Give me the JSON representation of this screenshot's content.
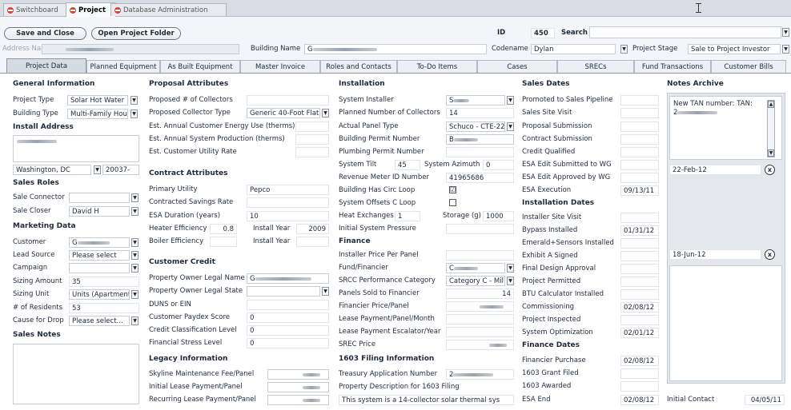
{
  "doc_tabs": [
    "Switchboard",
    "Project",
    "Database Administration"
  ],
  "buttons": {
    "save_close": "Save and Close",
    "open_folder": "Open Project Folder"
  },
  "header": {
    "id_label": "ID",
    "id_value": "450",
    "search_label": "Search",
    "address_label": "Address Name",
    "building_name_label": "Building Name",
    "codename_label": "Codename",
    "codename_value": "Dylan",
    "stage_label": "Project Stage",
    "stage_value": "Sale to Project Investor"
  },
  "section_tabs": [
    "Project Data",
    "Planned Equipment",
    "As Built Equipment",
    "Master Invoice",
    "Roles and Contacts",
    "To-Do Items",
    "Cases",
    "SRECs",
    "Fund Transactions",
    "Customer Bills"
  ],
  "general": {
    "title": "General Information",
    "project_type_label": "Project Type",
    "project_type": "Solar Hot Water",
    "building_type_label": "Building Type",
    "building_type": "Multi-Family Hou",
    "install_address_title": "Install Address",
    "city": "Washington, DC",
    "zip": "20037-",
    "sales_roles_title": "Sales Roles",
    "sale_connector_label": "Sale Connector",
    "sale_closer_label": "Sale Closer",
    "sale_closer": "David H",
    "marketing_title": "Marketing Data",
    "customer_label": "Customer",
    "customer_value": "G",
    "lead_source_label": "Lead Source",
    "lead_source": "Please select",
    "campaign_label": "Campaign",
    "sizing_amount_label": "Sizing Amount",
    "sizing_amount": "35",
    "sizing_unit_label": "Sizing Unit",
    "sizing_unit": "Units (Apartment",
    "residents_label": "# of Residents",
    "residents": "53",
    "drop_label": "Cause for Drop",
    "drop_value": "Please select...",
    "sales_notes_title": "Sales Notes"
  },
  "proposal": {
    "title": "Proposal Attributes",
    "collectors_label": "Proposed # of Collectors",
    "collector_type_label": "Proposed Collector Type",
    "collector_type": "Generic 40-Foot Flat",
    "energy_use_label": "Est. Annual Customer Energy Use (therms)",
    "production_label": "Est. Annual System Production (therms)",
    "utility_rate_label": "Est. Customer Utility Rate",
    "contract_title": "Contract Attributes",
    "primary_utility_label": "Primary Utility",
    "primary_utility": "Pepco",
    "savings_rate_label": "Contracted Savings Rate",
    "esa_duration_label": "ESA Duration (years)",
    "esa_duration": "10",
    "heater_eff_label": "Heater Efficiency",
    "heater_eff": "0.8",
    "install_year_label": "Install Year",
    "install_year": "2009",
    "boiler_eff_label": "Boiler Efficiency",
    "install_year2_label": "Install Year",
    "credit_title": "Customer Credit",
    "owner_name_label": "Property Owner Legal Name",
    "owner_name": "G",
    "owner_state_label": "Property Owner Legal State",
    "duns_label": "DUNS or EIN",
    "paydex_label": "Customer Paydex Score",
    "paydex": "0",
    "credit_class_label": "Credit Classification Level",
    "credit_class": "0",
    "stress_label": "Financial Stress Level",
    "stress": "0",
    "legacy_title": "Legacy Information",
    "skyline_label": "Skyline Maintenance Fee/Panel",
    "initial_lease_label": "Initial Lease Payment/Panel",
    "recurring_lease_label": "Recurring Lease Payment/Panel"
  },
  "installation": {
    "title": "Installation",
    "installer_label": "System Installer",
    "installer": "S",
    "planned_collectors_label": "Planned Number of Collectors",
    "planned_collectors": "14",
    "panel_type_label": "Actual Panel Type",
    "panel_type": "Schuco - CTE-22(",
    "building_permit_label": "Building Permit Number",
    "building_permit": "B",
    "plumbing_permit_label": "Plumbing Permit Number",
    "tilt_label": "System Tilt",
    "tilt": "45",
    "azimuth_label": "System Azimuth",
    "azimuth": "0",
    "meter_label": "Revenue Meter ID Number",
    "meter": "41965686",
    "circ_label": "Building Has Circ Loop",
    "circ_checked": "☑",
    "offsets_label": "System Offsets C Loop",
    "heat_ex_label": "Heat Exchanges",
    "heat_ex": "1",
    "storage_label": "Storage (g)",
    "storage": "1000",
    "pressure_label": "Initial System Pressure",
    "finance_title": "Finance",
    "price_panel_label": "Installer Price Per Panel",
    "financier_label": "Fund/Financier",
    "financier": "C",
    "srcc_label": "SRCC Performance Category",
    "srcc": "Category C - Mil",
    "panels_sold_label": "Panels Sold to Financier",
    "panels_sold": "14",
    "fin_price_label": "Financier Price/Panel",
    "lease_month_label": "Lease Payment/Panel/Month",
    "escalator_label": "Lease Payment Escalator/Year",
    "srec_price_label": "SREC Price",
    "filing_title": "1603 Filing Information",
    "treasury_label": "Treasury Application Number",
    "treasury": "2",
    "property_desc_label": "Property Description for 1603 Filing",
    "property_desc": "This system is a 14-collector solar thermal sys"
  },
  "sales_dates": {
    "title": "Sales Dates",
    "items": [
      "Promoted to Sales Pipeline",
      "Sales Site Visit",
      "Proposal Submission",
      "Contract Submission",
      "Credit Qualified",
      "ESA Edit Submitted to WG",
      "ESA Edit Approved by WG",
      "ESA Execution"
    ],
    "esa_execution": "09/13/11",
    "install_title": "Installation Dates",
    "install_items": [
      "Installer Site Visit",
      "Bypass Installed",
      "Emerald+Sensors Installed",
      "Exhibit A Signed",
      "Final Design Approval",
      "Project Permitted",
      "BTU Calculator Installed",
      "Commissioning",
      "Project Inspected",
      "System Optimization"
    ],
    "bypass": "01/31/12",
    "commissioning": "02/08/12",
    "optimization": "02/01/12",
    "finance_title": "Finance Dates",
    "finance_items": [
      "Financier Purchase",
      "1603 Grant Filed",
      "1603 Awarded",
      "ESA End"
    ],
    "financier_purchase": "02/08/12",
    "esa_end": "02/08/12"
  },
  "notes": {
    "title": "Notes Archive",
    "note1": "New TAN number: TAN:",
    "note1_line2": "2",
    "date1": "22-Feb-12",
    "date2": "18-Jun-12",
    "initial_contact_label": "Initial Contact",
    "initial_contact": "04/05/11",
    "delete_glyph": "x"
  },
  "glyphs": {
    "dropdown": "▼",
    "up": "▲",
    "down": "▼"
  }
}
